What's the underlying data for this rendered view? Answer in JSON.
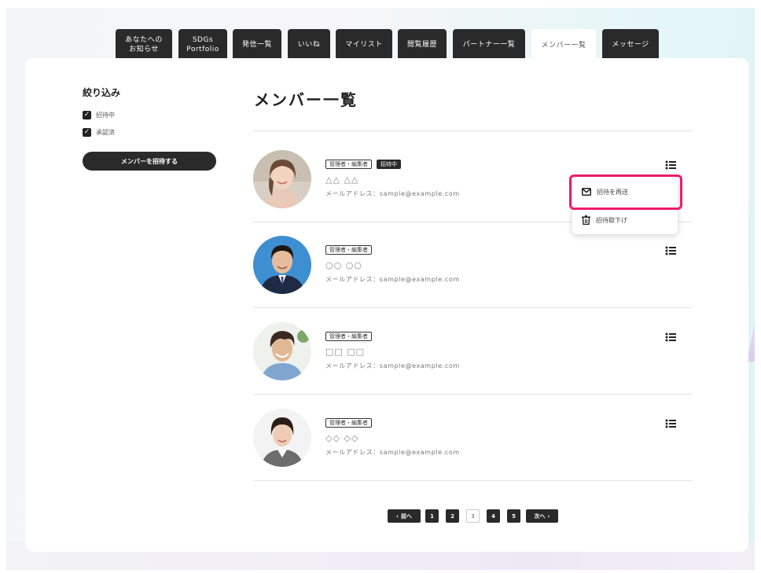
{
  "tabs": [
    {
      "label_line1": "あなたへの",
      "label_line2": "お知らせ"
    },
    {
      "label_line1": "SDGs",
      "label_line2": "Portfolio"
    },
    {
      "label": "発信一覧"
    },
    {
      "label": "いいね"
    },
    {
      "label": "マイリスト"
    },
    {
      "label": "閲覧履歴"
    },
    {
      "label": "パートナー一覧"
    },
    {
      "label": "メンバー一覧",
      "active": true
    },
    {
      "label": "メッセージ"
    }
  ],
  "sidebar": {
    "title": "絞り込み",
    "filters": [
      {
        "label": "招待中",
        "checked": true
      },
      {
        "label": "承認済",
        "checked": true
      }
    ],
    "invite_button": "メンバーを招待する"
  },
  "main": {
    "title": "メンバー一覧",
    "members": [
      {
        "role": "管理者・編集者",
        "status": "招待中",
        "name": "△△ △△",
        "email": "メールアドレス：sample@example.com"
      },
      {
        "role": "管理者・編集者",
        "name": "○○ ○○",
        "email": "メールアドレス：sample@example.com"
      },
      {
        "role": "管理者・編集者",
        "name": "□□ □□",
        "email": "メールアドレス：sample@example.com"
      },
      {
        "role": "管理者・編集者",
        "name": "◇◇ ◇◇",
        "email": "メールアドレス：sample@example.com"
      }
    ],
    "dropdown": {
      "resend": "招待を再送",
      "cancel": "招待取下げ"
    }
  },
  "pagination": {
    "prev": "前へ",
    "next": "次へ",
    "pages": [
      "1",
      "2",
      "3",
      "4",
      "5"
    ],
    "current": "3"
  },
  "colors": {
    "accent": "#ea1c6c",
    "dark": "#2a2a2a"
  }
}
